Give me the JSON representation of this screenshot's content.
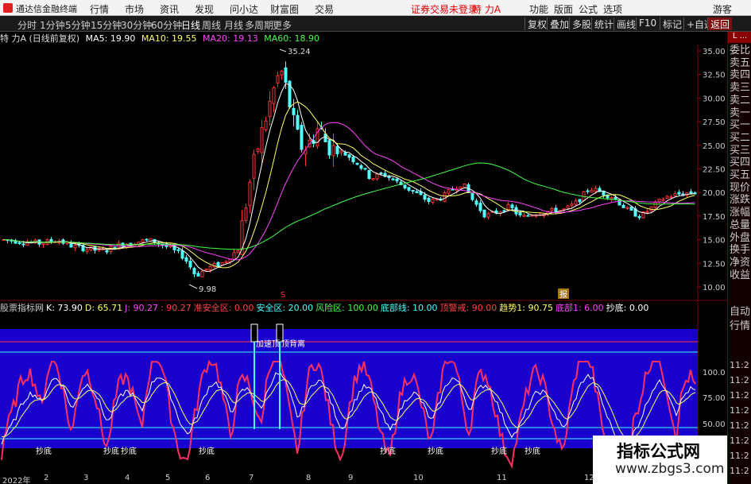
{
  "topbar": {
    "app_title": "通达信金融终端",
    "menus": [
      "行情",
      "市场",
      "资讯",
      "发现",
      "问小达",
      "财富圈",
      "交易"
    ],
    "notice": "证券交易未登录",
    "stock": "特 力A",
    "right_menus": [
      "功能",
      "版面",
      "公式",
      "选项"
    ],
    "guest": "游客"
  },
  "periods": [
    "分时",
    "1分钟",
    "5分钟",
    "15分钟",
    "30分钟",
    "60分钟",
    "日线",
    "周线",
    "月线",
    "多周期",
    "更多"
  ],
  "active_period": "日线",
  "tools": [
    "复权",
    "叠加",
    "多股",
    "统计",
    "画线",
    "F10",
    "标记",
    "+自选",
    "返回"
  ],
  "ma_legend": {
    "stock_label": "特 力A (日线前复权)",
    "items": [
      {
        "label": "MA5: 19.90",
        "color": "#ffffff"
      },
      {
        "label": "MA10: 19.55",
        "color": "#ffff66"
      },
      {
        "label": "MA20: 19.13",
        "color": "#ff44ff"
      },
      {
        "label": "MA60: 18.90",
        "color": "#44ff44"
      }
    ]
  },
  "price_axis": [
    "35.00",
    "32.50",
    "30.00",
    "27.50",
    "25.00",
    "22.50",
    "20.00",
    "17.50",
    "15.00",
    "12.50",
    "10.00"
  ],
  "high_label": "35.24",
  "low_label": "9.98",
  "marker_s": "S",
  "marker_report": "报",
  "indicator_legend": [
    {
      "label": "股票指标网",
      "color": "#cccccc"
    },
    {
      "label": "K: 73.90",
      "color": "#ffffff"
    },
    {
      "label": "D: 65.71",
      "color": "#ffff66"
    },
    {
      "label": "J: 90.27",
      "color": "#ff44ff"
    },
    {
      "label": ": 90.27",
      "color": "#ff4444"
    },
    {
      "label": "准安全区: 0.00",
      "color": "#ff4444"
    },
    {
      "label": "安全区: 20.00",
      "color": "#44ffff"
    },
    {
      "label": "风险区: 100.00",
      "color": "#44ff44"
    },
    {
      "label": "底部线: 10.00",
      "color": "#44ffff"
    },
    {
      "label": "顶警戒: 90.00",
      "color": "#ff4444"
    },
    {
      "label": "趋势1: 90.75",
      "color": "#ffff66"
    },
    {
      "label": "底部1: 6.00",
      "color": "#ff44ff"
    },
    {
      "label": "抄底: 0.00",
      "color": "#ffffff"
    }
  ],
  "indicator_axis": [
    "100.0",
    "75.00",
    "50.00"
  ],
  "annotations": [
    "加速顶",
    "顶背离"
  ],
  "chaodi_labels": [
    "抄底",
    "抄底",
    "抄底",
    "抄底",
    "抄底",
    "抄底",
    "抄底",
    "抄底",
    "抄底"
  ],
  "right_panel": {
    "header": "L ...",
    "items": [
      "委比",
      "卖五",
      "卖四",
      "卖三",
      "卖二",
      "卖一",
      "买一",
      "买二",
      "买三",
      "买四",
      "买五",
      "现价",
      "涨跌",
      "涨幅",
      "总量",
      "外盘",
      "换手",
      "净资",
      "收益",
      "自动",
      "行情"
    ],
    "times": [
      "11:2",
      "11:2",
      "11:2",
      "11:2",
      "11:2",
      "11:2",
      "11:2",
      "11:2"
    ]
  },
  "x_axis": [
    "2022年",
    "2",
    "3",
    "4",
    "5",
    "6",
    "7",
    "8",
    "9",
    "10",
    "11",
    "12"
  ],
  "watermark": {
    "title": "指标公式网",
    "url": "www.zbgs3.com"
  },
  "colors": {
    "up": "#ff3232",
    "down": "#54ffff",
    "ind_bg": "#1a00cc",
    "ma60": "#44ff44"
  }
}
